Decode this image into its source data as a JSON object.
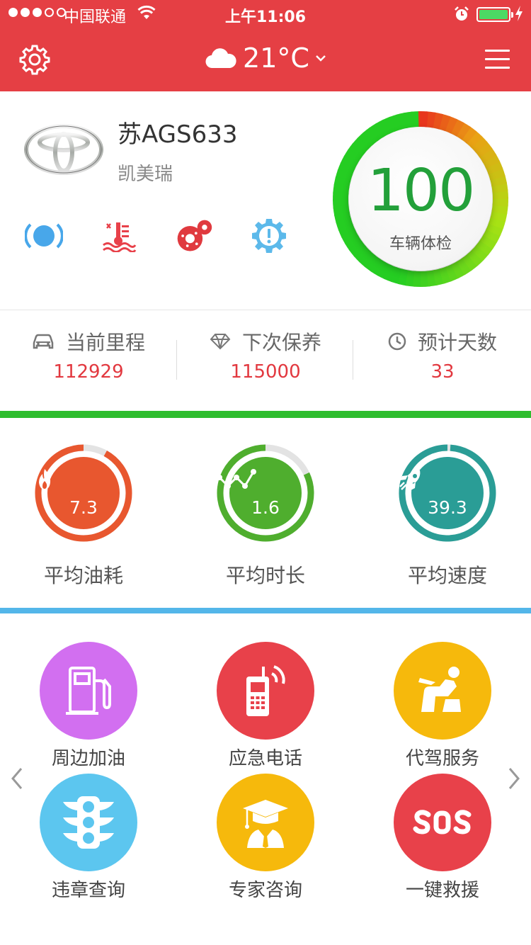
{
  "status_bar": {
    "carrier": "中国联通",
    "time": "上午11:06"
  },
  "nav": {
    "temperature": "21°C",
    "weather_icon": "cloud-icon"
  },
  "car": {
    "plate": "苏AGS633",
    "model": "凯美瑞",
    "brand_logo": "toyota-logo"
  },
  "health": {
    "score": "100",
    "label": "车辆体检"
  },
  "stats": [
    {
      "label": "当前里程",
      "value": "112929",
      "icon": "car-icon"
    },
    {
      "label": "下次保养",
      "value": "115000",
      "icon": "diamond-icon"
    },
    {
      "label": "预计天数",
      "value": "33",
      "icon": "clock-icon"
    }
  ],
  "metrics": [
    {
      "label": "平均油耗",
      "value": "7.3",
      "icon": "flame-icon",
      "color": "#e8572f",
      "ring_fill": 0.92
    },
    {
      "label": "平均时长",
      "value": "1.6",
      "icon": "line-chart-icon",
      "color": "#4fae2e",
      "ring_fill": 0.82
    },
    {
      "label": "平均速度",
      "value": "39.3",
      "icon": "rocket-icon",
      "color": "#2a9d96",
      "ring_fill": 0.99
    }
  ],
  "services": [
    {
      "label": "周边加油",
      "icon": "gas-pump-icon",
      "color": "#d26ff0"
    },
    {
      "label": "应急电话",
      "icon": "phone-icon",
      "color": "#e8414a"
    },
    {
      "label": "代驾服务",
      "icon": "driver-seat-icon",
      "color": "#f6b90c"
    },
    {
      "label": "违章查询",
      "icon": "traffic-light-icon",
      "color": "#5cc6ef"
    },
    {
      "label": "专家咨询",
      "icon": "graduate-icon",
      "color": "#f6b90c"
    },
    {
      "label": "一键救援",
      "icon": "sos-icon",
      "color": "#e8414a"
    }
  ],
  "colors": {
    "header": "#e53f44",
    "accent_red": "#e2383f",
    "green_bar": "#2ebd2e",
    "blue_bar": "#53b6e9"
  }
}
